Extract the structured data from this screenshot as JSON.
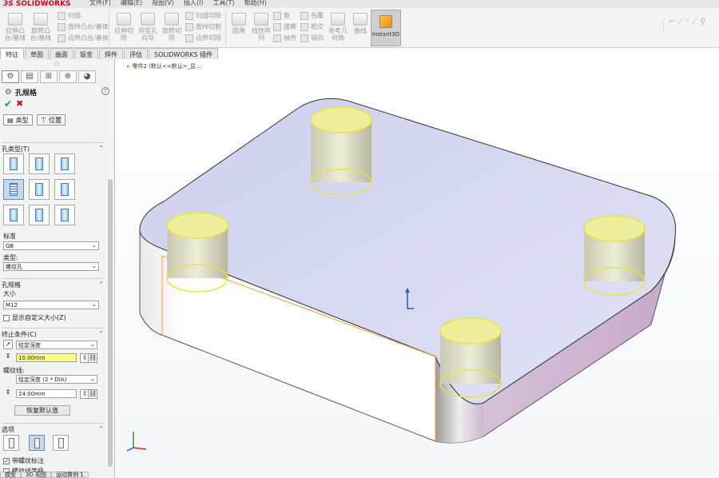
{
  "app": {
    "logo": "SOLIDWORKS",
    "logo_prefix": "3S"
  },
  "menu": [
    "文件(F)",
    "编辑(E)",
    "视图(V)",
    "插入(I)",
    "工具(T)",
    "帮助(H)"
  ],
  "ribbon": {
    "features": {
      "extrude_boss": "拉伸凸台/基体",
      "revolve_boss": "旋转凸台/基体",
      "sweep": "扫描",
      "loft": "放样凸台/基体",
      "boundary": "边界凸台/基体",
      "extrude_cut": "拉伸切除",
      "hole_wizard": "异型孔向导",
      "revolve_cut": "旋转切除",
      "sweep_cut": "扫描切除",
      "loft_cut": "放样切割",
      "boundary_cut": "边界切除",
      "fillet": "圆角",
      "linear_pattern": "线性阵列",
      "rib": "筋",
      "draft": "拔模",
      "shell": "抽壳",
      "wrap": "包覆",
      "intersect": "相交",
      "mirror": "镜向",
      "reference_geometry": "参考几何体",
      "curves": "曲线",
      "instant3d": "Instant3D"
    }
  },
  "tabs": [
    "特征",
    "草图",
    "曲面",
    "钣金",
    "焊件",
    "评估",
    "SOLIDWORKS 插件"
  ],
  "active_tab": "特征",
  "panel": {
    "title": "孔规格",
    "subtabs": [
      "类型",
      "位置"
    ],
    "hole_type_label": "孔类型(T)",
    "standard_label": "标准",
    "standard_value": "GB",
    "type_label": "类型:",
    "type_value": "螺纹孔",
    "spec_header": "孔规格",
    "size_label": "大小",
    "size_value": "M12",
    "custom_size_label": "显示自定义大小(Z)",
    "end_condition_header": "终止条件(C)",
    "end_condition_value": "给定深度",
    "depth_value": "10.00mm",
    "thread_label": "螺纹线:",
    "thread_value": "给定深度 (2 * DIA)",
    "thread_depth_value": "24.00mm",
    "restore_button": "恢复默认值",
    "options_header": "选项",
    "thread_callout_label": "带螺纹标注",
    "thread_class_label": "螺纹线等级"
  },
  "viewport": {
    "breadcrumb": "零件2 (默认<<默认>_显..."
  },
  "bottom_tabs": [
    "模型",
    "3D 视图",
    "运动算例 1"
  ],
  "colors": {
    "accent": "#4a7cbb",
    "top_face": "#d4d6ef",
    "side_face": "#d9c3dc",
    "boss_edge": "#e6e24a",
    "arrow": "#e02020"
  }
}
